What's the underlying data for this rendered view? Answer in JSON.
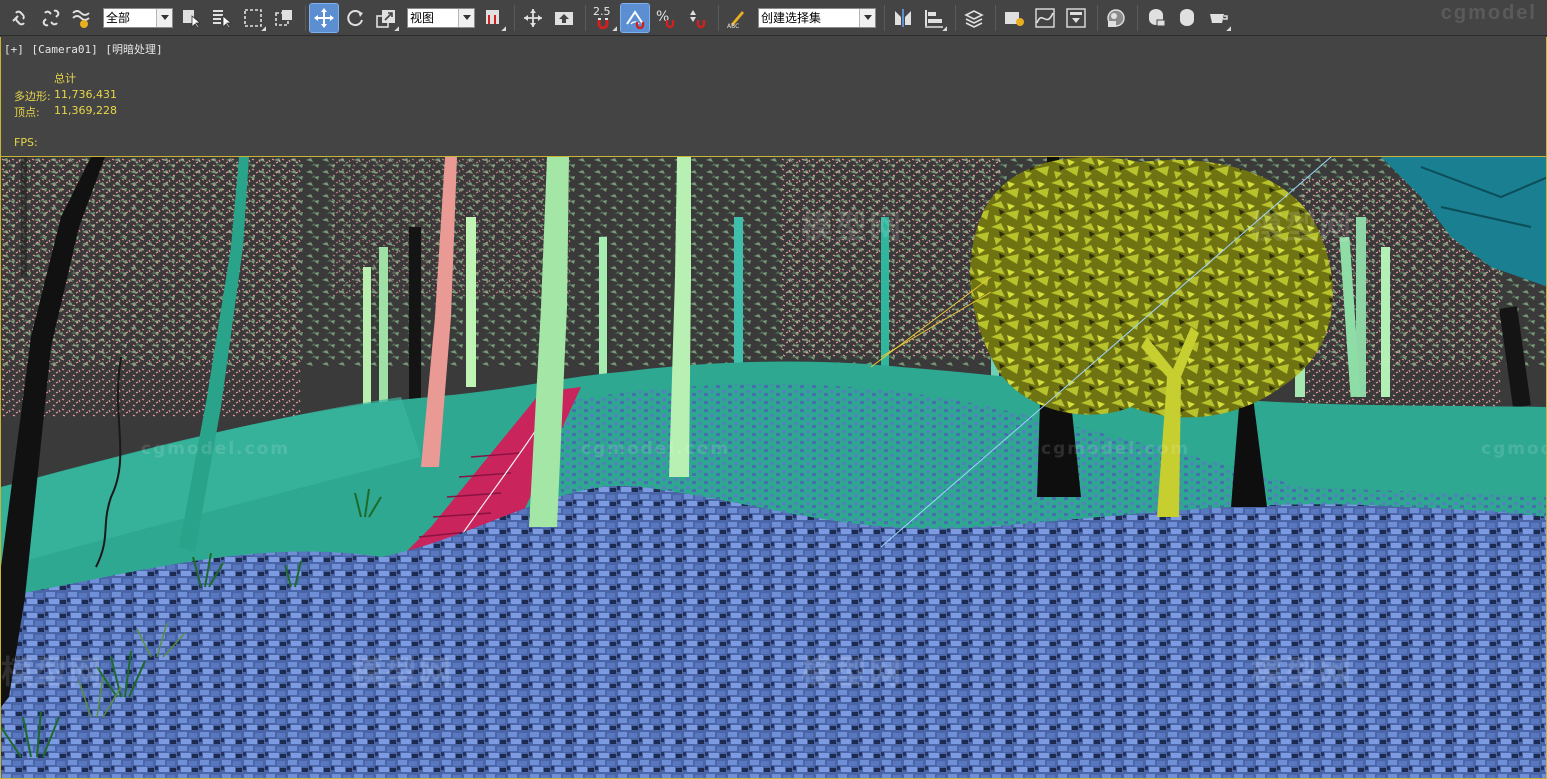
{
  "toolbar": {
    "selection_filter": "全部",
    "reference_coord": "视图",
    "snap_value": "2.5",
    "named_selection": "创建选择集",
    "watermark": "cgmodel"
  },
  "viewport": {
    "menu_plus": "[+]",
    "camera": "[Camera01]",
    "shading": "[明暗处理]"
  },
  "stats": {
    "title": "总计",
    "polys_label": "多边形:",
    "polys_value": "11,736,431",
    "verts_label": "顶点:",
    "verts_value": "11,369,228",
    "fps_label": "FPS:"
  },
  "watermarks": {
    "brand_cn": "模型网",
    "brand_en": "cgmodel.com"
  },
  "colors": {
    "accent_active": "#5b8fd1",
    "viewport_border": "#c9b43a",
    "stats_text": "#e6d64a",
    "ui_background": "#444444"
  },
  "icons": [
    "link-icon",
    "unlink-icon",
    "bind-space-warp-icon",
    "select-object-icon",
    "select-by-name-icon",
    "rectangle-selection-icon",
    "window-crossing-icon",
    "select-move-icon",
    "select-rotate-icon",
    "select-scale-icon",
    "select-manipulate-icon",
    "pivot-center-icon",
    "keyboard-shortcut-icon",
    "snap-toggle-icon",
    "angle-snap-icon",
    "percent-snap-icon",
    "spinner-snap-icon",
    "edit-named-selection-icon",
    "mirror-icon",
    "align-icon",
    "layer-explorer-icon",
    "toggle-scene-explorer-icon",
    "curve-editor-icon",
    "schematic-view-icon",
    "material-editor-icon",
    "render-setup-icon",
    "rendered-frame-window-icon",
    "render-production-icon"
  ]
}
